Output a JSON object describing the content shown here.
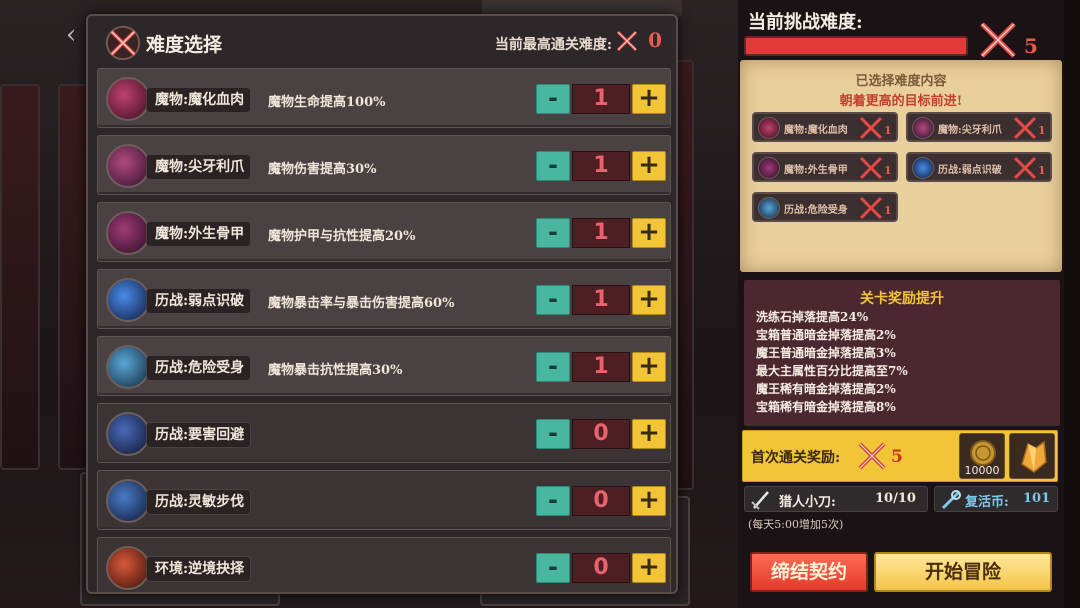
{
  "panel": {
    "title": "难度选择",
    "max_clear_label": "当前最高通关难度:",
    "max_clear_value": "0"
  },
  "modifiers": [
    {
      "name": "魔物:魔化血肉",
      "desc": "魔物生命提高100%",
      "count": "1",
      "icon_color": "#8b2040",
      "active": true
    },
    {
      "name": "魔物:尖牙利爪",
      "desc": "魔物伤害提高30%",
      "count": "1",
      "icon_color": "#7a2a50",
      "active": true
    },
    {
      "name": "魔物:外生骨甲",
      "desc": "魔物护甲与抗性提高20%",
      "count": "1",
      "icon_color": "#6a2048",
      "active": true
    },
    {
      "name": "历战:弱点识破",
      "desc": "魔物暴击率与暴击伤害提高60%",
      "count": "1",
      "icon_color": "#2a4a8a",
      "active": true
    },
    {
      "name": "历战:危险受身",
      "desc": "魔物暴击抗性提高30%",
      "count": "1",
      "icon_color": "#2a5a7a",
      "active": true
    },
    {
      "name": "历战:要害回避",
      "desc": "",
      "count": "0",
      "icon_color": "#2a3a6a",
      "active": false
    },
    {
      "name": "历战:灵敏步伐",
      "desc": "",
      "count": "0",
      "icon_color": "#2a4a7a",
      "active": false
    },
    {
      "name": "环境:逆境抉择",
      "desc": "",
      "count": "0",
      "icon_color": "#8a3020",
      "active": false
    }
  ],
  "buttons": {
    "minus": "-",
    "plus": "+"
  },
  "side": {
    "title": "当前挑战难度:",
    "difficulty_value": "5",
    "selected_title": "已选择难度内容",
    "selected_subtitle": "朝着更高的目标前进!",
    "chips": [
      {
        "name": "魔物:魔化血肉",
        "count": "1",
        "icon_color": "#8b2040"
      },
      {
        "name": "魔物:尖牙利爪",
        "count": "1",
        "icon_color": "#7a2a50"
      },
      {
        "name": "魔物:外生骨甲",
        "count": "1",
        "icon_color": "#6a2048"
      },
      {
        "name": "历战:弱点识破",
        "count": "1",
        "icon_color": "#2a4a8a"
      },
      {
        "name": "历战:危险受身",
        "count": "1",
        "icon_color": "#2a5a7a"
      }
    ],
    "reward_title": "关卡奖励提升",
    "reward_lines": [
      "洗练石掉落提高24%",
      "宝箱普通暗金掉落提高2%",
      "魔王普通暗金掉落提高3%",
      "最大主属性百分比提高至7%",
      "魔王稀有暗金掉落提高2%",
      "宝箱稀有暗金掉落提高8%"
    ],
    "first_clear_label": "首次通关奖励:",
    "first_clear_value": "5",
    "coin_count": "10000",
    "knife_label": "猎人小刀:",
    "knife_value": "10/10",
    "revive_label": "复活币:",
    "revive_value": "101",
    "daily_note": "(每天5:00增加5次)",
    "contract_button": "缔结契约",
    "start_button": "开始冒险"
  },
  "colors": {
    "minus_button": "#49b7a0",
    "plus_button": "#f2c537",
    "count_text": "#e8636c",
    "difficulty_red": "#e85a4f",
    "parchment": "#e9cf9c"
  },
  "icons": {
    "difficulty": "crossed-swords-icon",
    "knife": "knife-icon",
    "revive": "revive-coin-icon",
    "back": "back-arrow-icon"
  }
}
